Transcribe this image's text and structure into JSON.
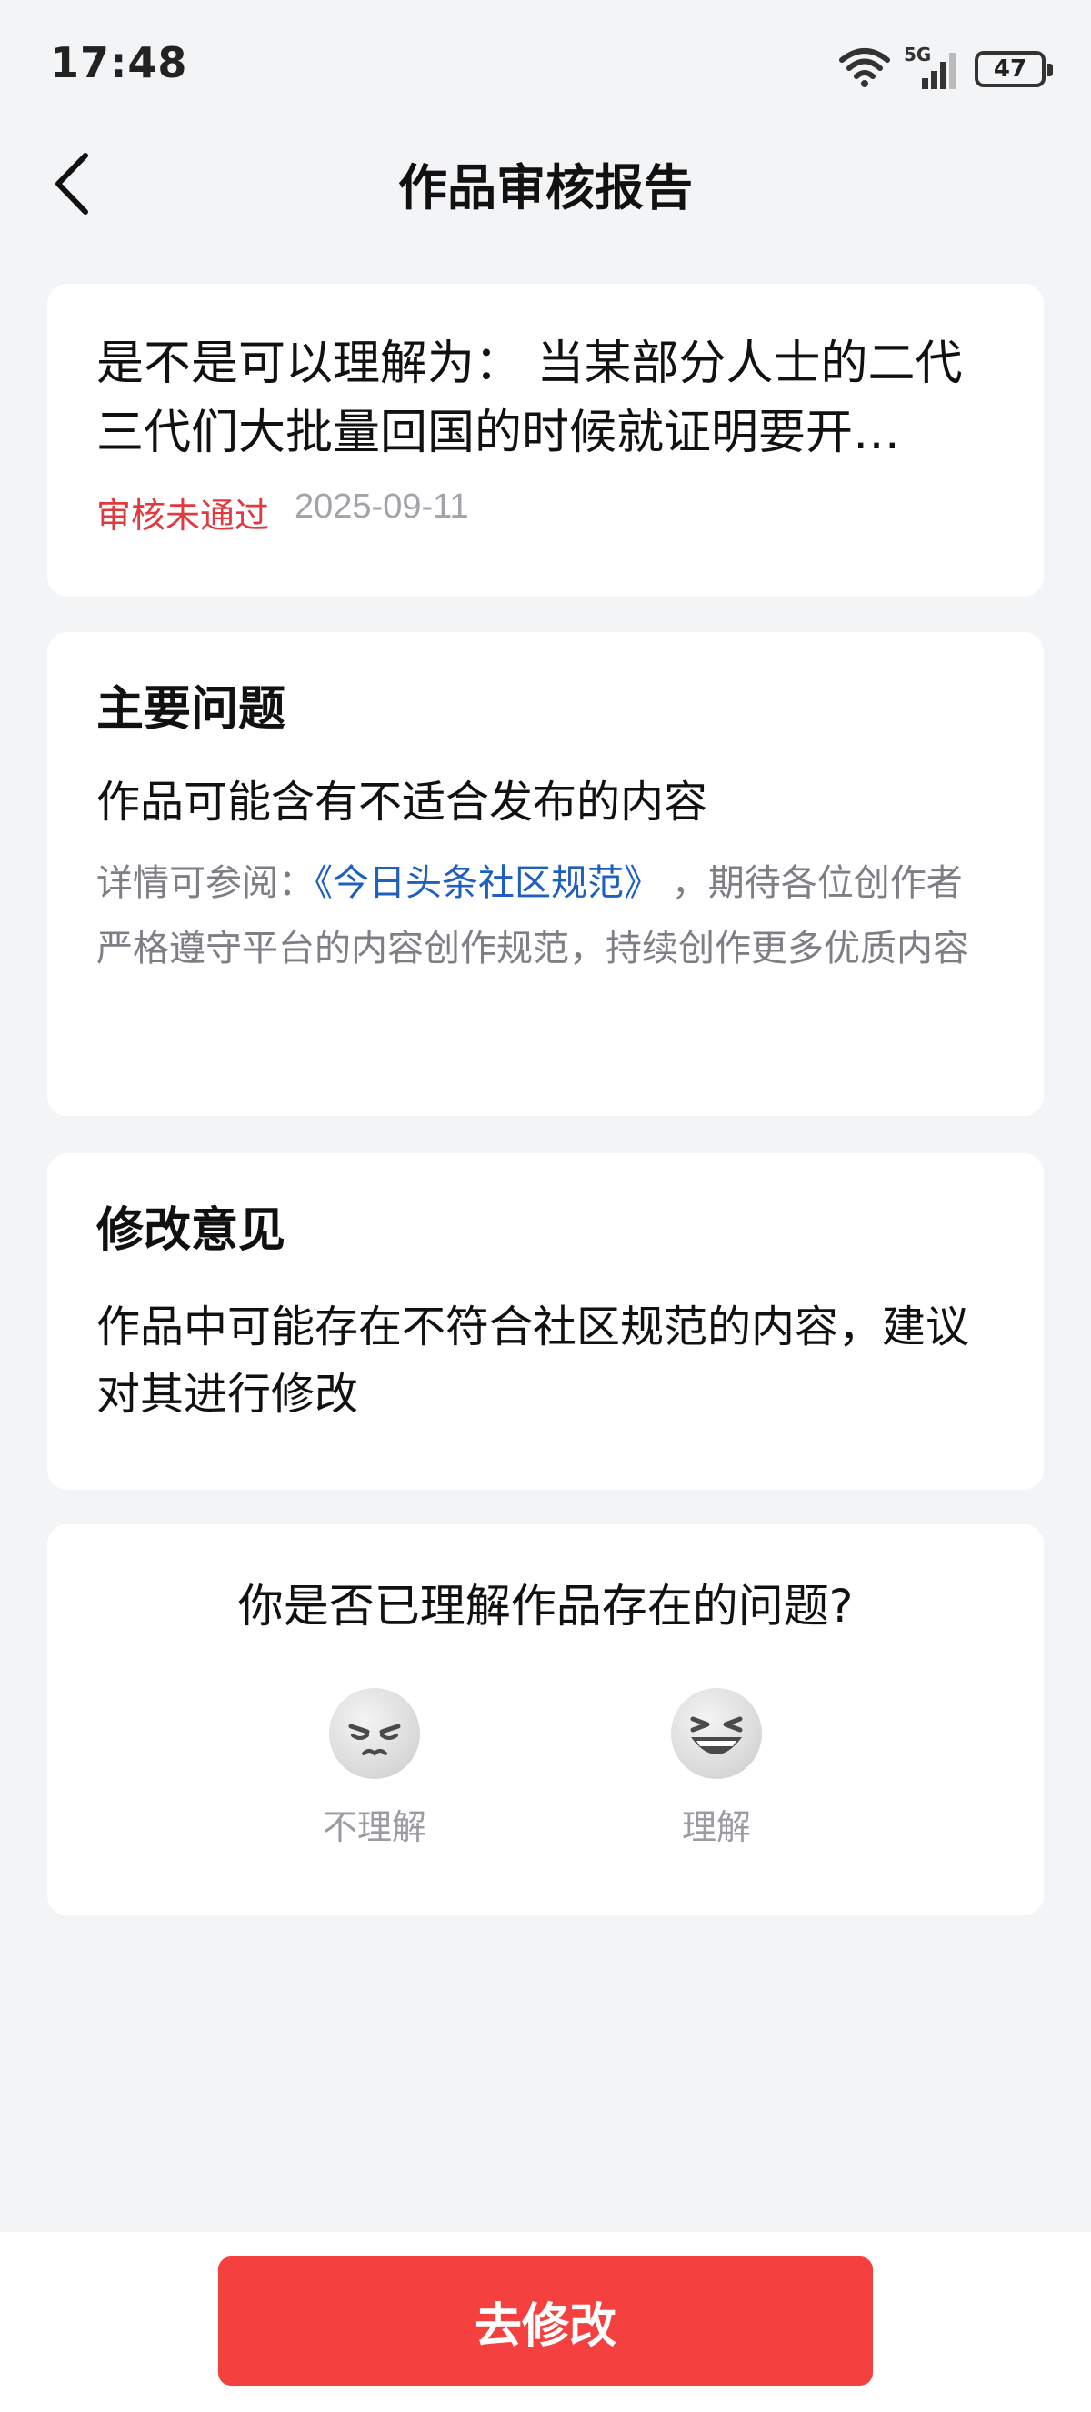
{
  "status_bar": {
    "time": "17:48",
    "battery": "47",
    "network": "5G",
    "icons": [
      "wifi-icon",
      "cellular-signal-icon",
      "battery-icon"
    ]
  },
  "nav": {
    "title": "作品审核报告",
    "back_icon": "chevron-left-icon"
  },
  "article": {
    "title": "是不是可以理解为： 当某部分人士的二代三代们大批量回国的时候就证明要开…",
    "status": "审核未通过",
    "date": "2025-09-11",
    "status_color": "#e0393e"
  },
  "issue": {
    "heading": "主要问题",
    "summary": "作品可能含有不适合发布的内容",
    "detail_prefix": "详情可参阅：",
    "guideline_link": "《今日头条社区规范》",
    "detail_suffix": " ，期待各位创作者严格遵守平台的内容创作规范，持续创作更多优质内容",
    "link_color": "#1f5fbf"
  },
  "advice": {
    "heading": "修改意见",
    "text": "作品中可能存在不符合社区规范的内容，建议对其进行修改"
  },
  "survey": {
    "question": "你是否已理解作品存在的问题?",
    "options": [
      {
        "label": "不理解",
        "icon": "confused-face-icon"
      },
      {
        "label": "理解",
        "icon": "laughing-face-icon"
      }
    ]
  },
  "footer": {
    "edit_label": "去修改",
    "accent": "#f54040"
  }
}
